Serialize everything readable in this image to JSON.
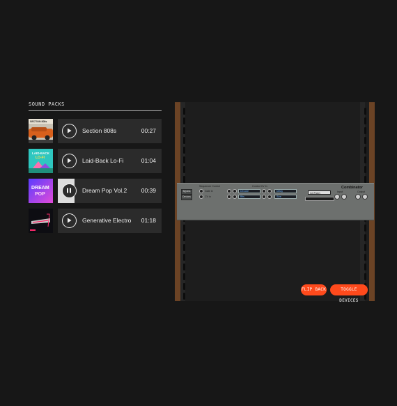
{
  "sound_packs": {
    "title": "SOUND PACKS",
    "items": [
      {
        "name": "Section 808s",
        "duration": "00:27",
        "cover_text": "SECTION 808s",
        "state": "play",
        "progress": 0
      },
      {
        "name": "Laid-Back Lo-Fi",
        "duration": "01:04",
        "cover_text": "LAID-BACK LO-FI",
        "state": "play",
        "progress": 0
      },
      {
        "name": "Dream Pop Vol.2",
        "duration": "00:39",
        "cover_text": "DREAM POP",
        "state": "pause",
        "progress": 0.16
      },
      {
        "name": "Generative Electro",
        "duration": "01:18",
        "cover_text": "ELECTRO",
        "state": "play",
        "progress": 0
      }
    ]
  },
  "rack": {
    "device": {
      "name": "Combinator",
      "sequencer_label": "Sequencer Control",
      "gate_label": "Gate in",
      "cv_label": "CV in",
      "select_label": "Select",
      "bypass_label": "Bypass",
      "devices_label": "Devices",
      "control_cv_label": "Control CV In",
      "selectors": [
        "Rotary 1",
        "Rotary 2",
        "Rotary 3",
        "Rotary 4"
      ],
      "selector_values": [
        "Decode",
        "Bits",
        "Delay",
        "Size"
      ],
      "patch_name": "Init Patch",
      "input_label": "Input",
      "output_label": "Output"
    }
  },
  "buttons": {
    "flip_back": "FLIP BACK",
    "toggle_devices": "TOGGLE DEVICES"
  },
  "colors": {
    "background": "#171717",
    "card": "#2b2b2b",
    "accent": "#ff4a1c",
    "rail_wood": "#6b4325",
    "device_panel": "#6d706e"
  }
}
